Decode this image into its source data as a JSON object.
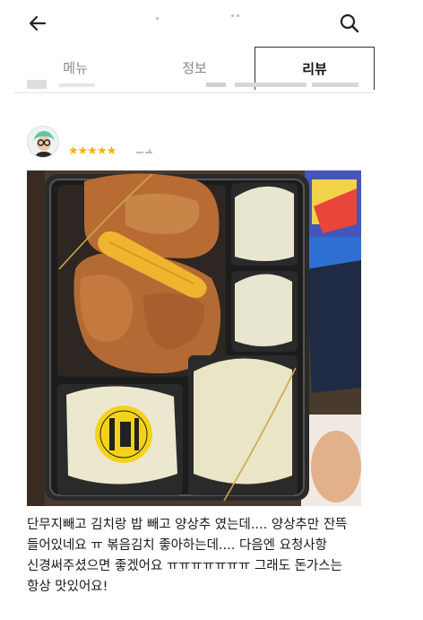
{
  "header": {
    "back_icon": "back-arrow-icon",
    "search_icon": "search-icon"
  },
  "tabs": [
    {
      "label": "메뉴",
      "active": false
    },
    {
      "label": "정보",
      "active": false
    },
    {
      "label": "리뷰",
      "active": true
    }
  ],
  "review": {
    "rating": 5,
    "stars_text": "★★★★★",
    "text_lines": [
      "단무지빼고 김치랑 밥 빼고 양상추 였는데.... 양상추만 잔뜩",
      "들어있네요 ㅠ 볶음김치 좋아하는데.... 다음엔 요청사항",
      "신경써주셨으면 좋겠어요 ㅠㅠㅠㅠㅠㅠㅠ 그래도 돈가스는",
      "항상 맛있어요!"
    ]
  },
  "colors": {
    "star": "#f4b400",
    "tab_active": "#111111",
    "tab_inactive": "#888888"
  }
}
